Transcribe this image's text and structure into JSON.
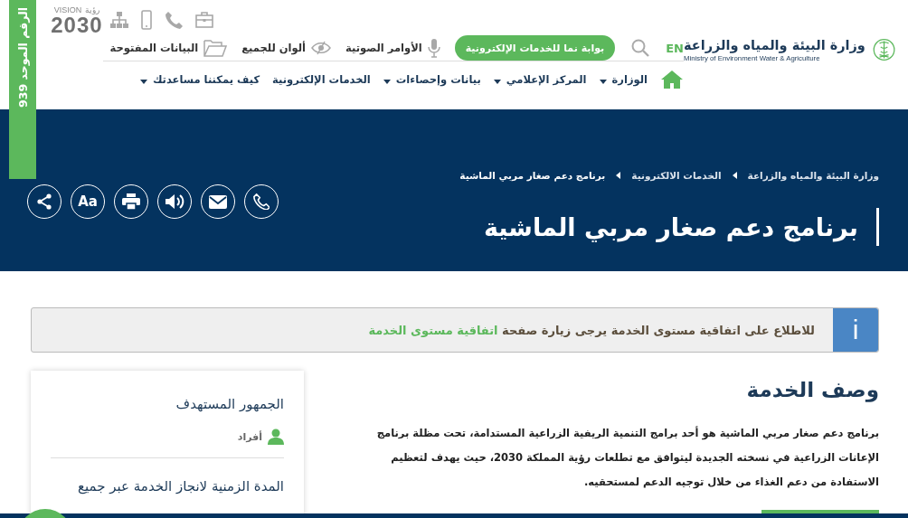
{
  "side_tab": {
    "label": "الرقم الموحد 939"
  },
  "brand": {
    "name": "وزارة البيئة والمياه والزراعة",
    "name_en": "Ministry of Environment Water & Agriculture"
  },
  "vision": {
    "word": "VISION",
    "arabic": "رؤية",
    "year": "2030"
  },
  "language": "EN",
  "portal_button": "بوابة نما للخدمات الإلكترونية",
  "tools": [
    {
      "kind": "mic",
      "label": "الأوامر الصوتية"
    },
    {
      "kind": "eye",
      "label": "ألوان للجميع"
    },
    {
      "kind": "folder",
      "label": "البيانات المفتوحة"
    }
  ],
  "quick_icons": [
    {
      "kind": "briefcase"
    },
    {
      "kind": "phone"
    },
    {
      "kind": "mobile"
    },
    {
      "kind": "sitemap"
    }
  ],
  "nav": [
    {
      "label": "الوزارة",
      "dropdown": true
    },
    {
      "label": "المركز الإعلامي",
      "dropdown": true
    },
    {
      "label": "بيانات وإحصاءات",
      "dropdown": true
    },
    {
      "label": "الخدمات الإلكترونية",
      "dropdown": false
    },
    {
      "label": "كيف يمكننا مساعدتك",
      "dropdown": true
    }
  ],
  "breadcrumb": [
    {
      "label": "وزارة البيئة والمياه والزراعة",
      "current": false
    },
    {
      "label": "الخدمات الالكترونية",
      "current": false
    },
    {
      "label": "برنامج دعم صغار مربي الماشية",
      "current": true
    }
  ],
  "page_title": "برنامج دعم صغار مربي الماشية",
  "actions": [
    {
      "kind": "call"
    },
    {
      "kind": "mail"
    },
    {
      "kind": "sound"
    },
    {
      "kind": "print"
    },
    {
      "kind": "font",
      "label": "Aa"
    },
    {
      "kind": "share"
    }
  ],
  "notice": {
    "icon": "i",
    "text": "للاطلاع على اتفاقية مستوى الخدمة يرجى زيارة صفحة",
    "link": "اتفاقية مستوى الخدمة"
  },
  "description": {
    "heading": "وصف الخدمة",
    "text": "برنامج دعم صغار مربي الماشية هو أحد برامج التنمية الريفية الزراعية المستدامة، تحت مظلة برنامج الإعانات الزراعية في نسخته الجديدة ليتوافق مع تطلعات رؤية المملكة 2030، حيث يهدف لتعظيم الاستفادة من دعم الغذاء من خلال توجيه الدعم لمستحقيه."
  },
  "side_card": {
    "audience_heading": "الجمهور المستهدف",
    "audience": [
      {
        "kind": "person",
        "label": "أفراد"
      }
    ],
    "duration_heading": "المدة الزمنية لانجاز الخدمة عبر جميع"
  }
}
